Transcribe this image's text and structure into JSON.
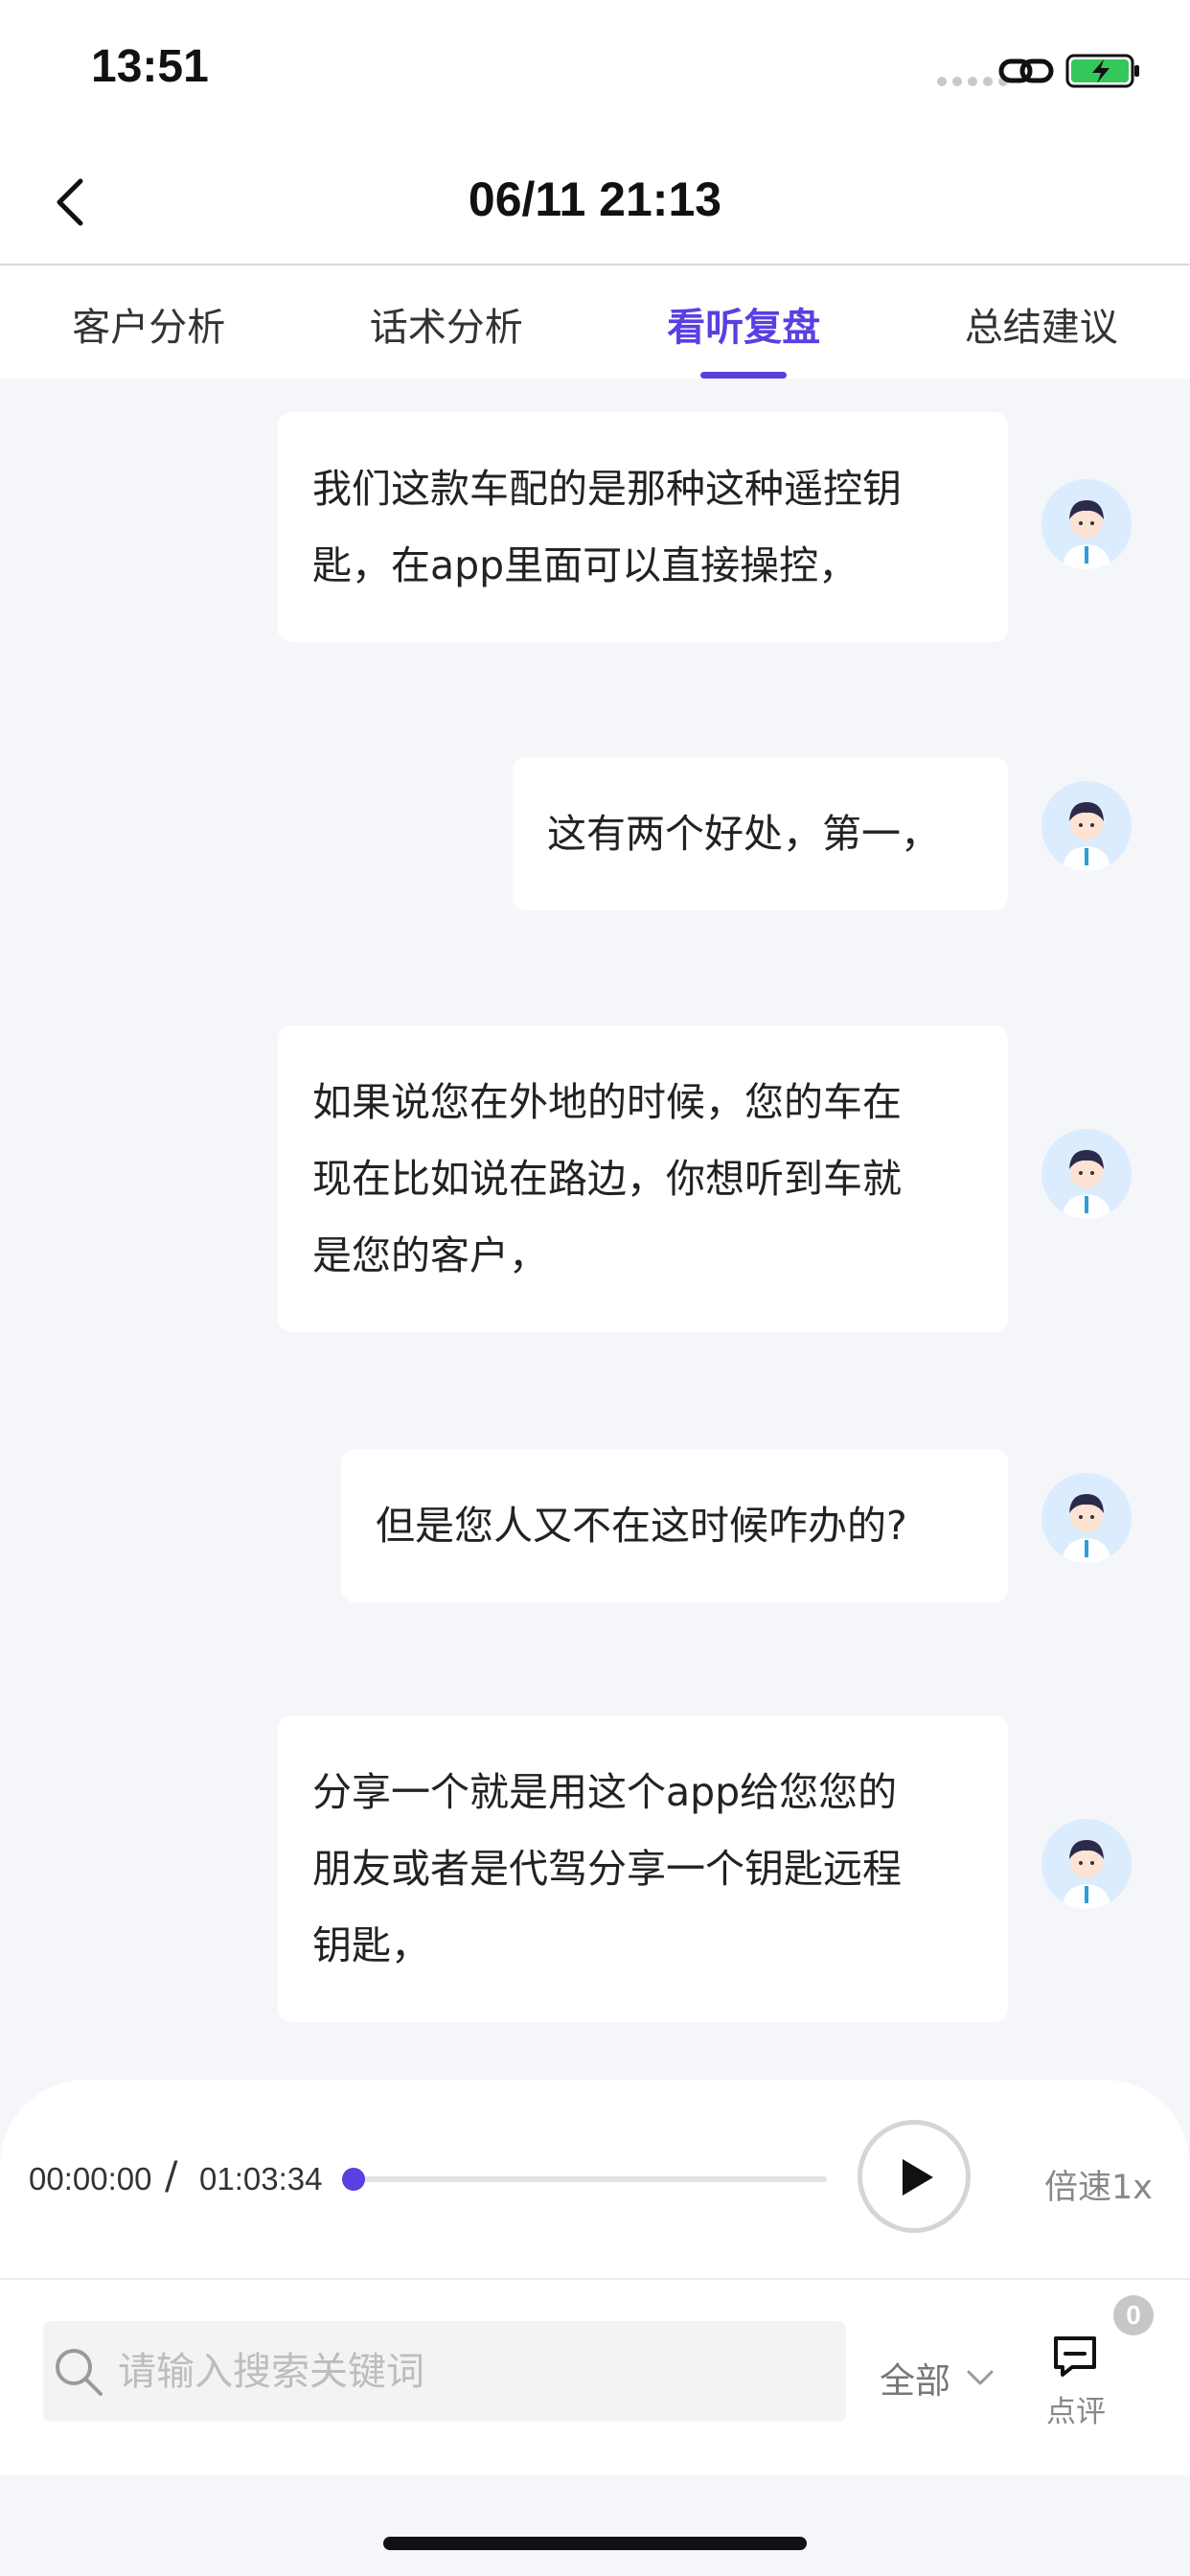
{
  "status_bar": {
    "time": "13:51",
    "battery_color": "#34c759"
  },
  "header": {
    "title": "06/11 21:13",
    "back_icon": "chevron-left-icon"
  },
  "tabs": [
    {
      "label": "客户分析",
      "active": false
    },
    {
      "label": "话术分析",
      "active": false
    },
    {
      "label": "看听复盘",
      "active": true
    },
    {
      "label": "总结建议",
      "active": false
    }
  ],
  "accent_color": "#5b3fe0",
  "messages": [
    {
      "lines": [
        "我们这款车配的是那种这种遥控钥",
        "匙，在app里面可以直接操控，"
      ]
    },
    {
      "lines": [
        "这有两个好处，第一，"
      ]
    },
    {
      "lines": [
        "如果说您在外地的时候，您的车在",
        "现在比如说在路边，你想听到车就",
        "是您的客户，"
      ]
    },
    {
      "lines": [
        "但是您人又不在这时候咋办的?"
      ]
    },
    {
      "lines": [
        "分享一个就是用这个app给您您的",
        "朋友或者是代驾分享一个钥匙远程",
        "钥匙，"
      ]
    }
  ],
  "player": {
    "current_time": "00:00:00",
    "separator": "/",
    "total_time": "01:03:34",
    "progress": 0.0,
    "speed_label": "倍速1x"
  },
  "search": {
    "placeholder": "请输入搜索关键词",
    "value": ""
  },
  "filter": {
    "selected": "全部"
  },
  "comment": {
    "label": "点评",
    "badge_count": "0"
  }
}
